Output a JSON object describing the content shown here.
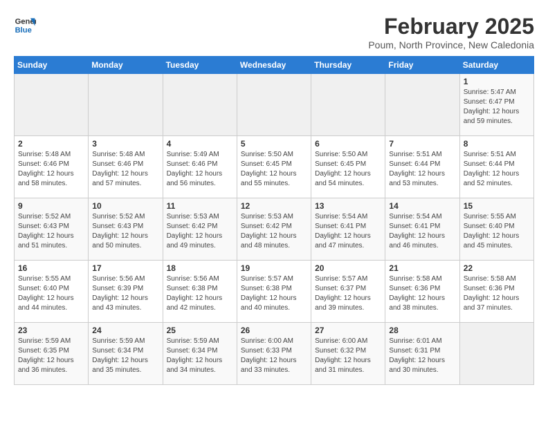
{
  "header": {
    "logo_line1": "General",
    "logo_line2": "Blue",
    "month": "February 2025",
    "location": "Poum, North Province, New Caledonia"
  },
  "days_of_week": [
    "Sunday",
    "Monday",
    "Tuesday",
    "Wednesday",
    "Thursday",
    "Friday",
    "Saturday"
  ],
  "weeks": [
    [
      {
        "day": "",
        "detail": ""
      },
      {
        "day": "",
        "detail": ""
      },
      {
        "day": "",
        "detail": ""
      },
      {
        "day": "",
        "detail": ""
      },
      {
        "day": "",
        "detail": ""
      },
      {
        "day": "",
        "detail": ""
      },
      {
        "day": "1",
        "detail": "Sunrise: 5:47 AM\nSunset: 6:47 PM\nDaylight: 12 hours\nand 59 minutes."
      }
    ],
    [
      {
        "day": "2",
        "detail": "Sunrise: 5:48 AM\nSunset: 6:46 PM\nDaylight: 12 hours\nand 58 minutes."
      },
      {
        "day": "3",
        "detail": "Sunrise: 5:48 AM\nSunset: 6:46 PM\nDaylight: 12 hours\nand 57 minutes."
      },
      {
        "day": "4",
        "detail": "Sunrise: 5:49 AM\nSunset: 6:46 PM\nDaylight: 12 hours\nand 56 minutes."
      },
      {
        "day": "5",
        "detail": "Sunrise: 5:50 AM\nSunset: 6:45 PM\nDaylight: 12 hours\nand 55 minutes."
      },
      {
        "day": "6",
        "detail": "Sunrise: 5:50 AM\nSunset: 6:45 PM\nDaylight: 12 hours\nand 54 minutes."
      },
      {
        "day": "7",
        "detail": "Sunrise: 5:51 AM\nSunset: 6:44 PM\nDaylight: 12 hours\nand 53 minutes."
      },
      {
        "day": "8",
        "detail": "Sunrise: 5:51 AM\nSunset: 6:44 PM\nDaylight: 12 hours\nand 52 minutes."
      }
    ],
    [
      {
        "day": "9",
        "detail": "Sunrise: 5:52 AM\nSunset: 6:43 PM\nDaylight: 12 hours\nand 51 minutes."
      },
      {
        "day": "10",
        "detail": "Sunrise: 5:52 AM\nSunset: 6:43 PM\nDaylight: 12 hours\nand 50 minutes."
      },
      {
        "day": "11",
        "detail": "Sunrise: 5:53 AM\nSunset: 6:42 PM\nDaylight: 12 hours\nand 49 minutes."
      },
      {
        "day": "12",
        "detail": "Sunrise: 5:53 AM\nSunset: 6:42 PM\nDaylight: 12 hours\nand 48 minutes."
      },
      {
        "day": "13",
        "detail": "Sunrise: 5:54 AM\nSunset: 6:41 PM\nDaylight: 12 hours\nand 47 minutes."
      },
      {
        "day": "14",
        "detail": "Sunrise: 5:54 AM\nSunset: 6:41 PM\nDaylight: 12 hours\nand 46 minutes."
      },
      {
        "day": "15",
        "detail": "Sunrise: 5:55 AM\nSunset: 6:40 PM\nDaylight: 12 hours\nand 45 minutes."
      }
    ],
    [
      {
        "day": "16",
        "detail": "Sunrise: 5:55 AM\nSunset: 6:40 PM\nDaylight: 12 hours\nand 44 minutes."
      },
      {
        "day": "17",
        "detail": "Sunrise: 5:56 AM\nSunset: 6:39 PM\nDaylight: 12 hours\nand 43 minutes."
      },
      {
        "day": "18",
        "detail": "Sunrise: 5:56 AM\nSunset: 6:38 PM\nDaylight: 12 hours\nand 42 minutes."
      },
      {
        "day": "19",
        "detail": "Sunrise: 5:57 AM\nSunset: 6:38 PM\nDaylight: 12 hours\nand 40 minutes."
      },
      {
        "day": "20",
        "detail": "Sunrise: 5:57 AM\nSunset: 6:37 PM\nDaylight: 12 hours\nand 39 minutes."
      },
      {
        "day": "21",
        "detail": "Sunrise: 5:58 AM\nSunset: 6:36 PM\nDaylight: 12 hours\nand 38 minutes."
      },
      {
        "day": "22",
        "detail": "Sunrise: 5:58 AM\nSunset: 6:36 PM\nDaylight: 12 hours\nand 37 minutes."
      }
    ],
    [
      {
        "day": "23",
        "detail": "Sunrise: 5:59 AM\nSunset: 6:35 PM\nDaylight: 12 hours\nand 36 minutes."
      },
      {
        "day": "24",
        "detail": "Sunrise: 5:59 AM\nSunset: 6:34 PM\nDaylight: 12 hours\nand 35 minutes."
      },
      {
        "day": "25",
        "detail": "Sunrise: 5:59 AM\nSunset: 6:34 PM\nDaylight: 12 hours\nand 34 minutes."
      },
      {
        "day": "26",
        "detail": "Sunrise: 6:00 AM\nSunset: 6:33 PM\nDaylight: 12 hours\nand 33 minutes."
      },
      {
        "day": "27",
        "detail": "Sunrise: 6:00 AM\nSunset: 6:32 PM\nDaylight: 12 hours\nand 31 minutes."
      },
      {
        "day": "28",
        "detail": "Sunrise: 6:01 AM\nSunset: 6:31 PM\nDaylight: 12 hours\nand 30 minutes."
      },
      {
        "day": "",
        "detail": ""
      }
    ]
  ]
}
